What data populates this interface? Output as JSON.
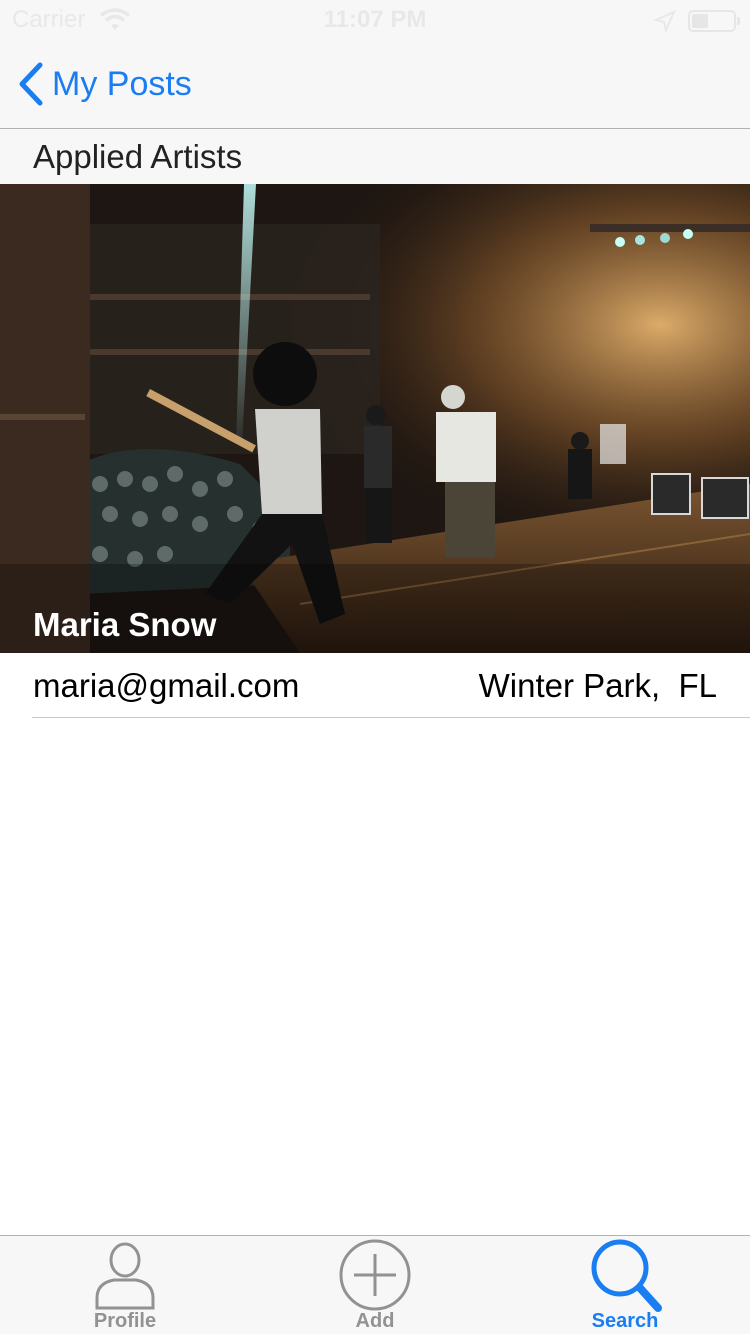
{
  "status_bar": {
    "carrier": "Carrier",
    "time": "11:07 PM",
    "icons": [
      "wifi-icon",
      "location-arrow-icon",
      "battery-icon"
    ]
  },
  "nav": {
    "back_label": "My Posts",
    "back_icon": "chevron-left-icon"
  },
  "section": {
    "title": "Applied Artists"
  },
  "artists": [
    {
      "name": "Maria Snow",
      "email": "maria@gmail.com",
      "location": "Winter Park,  FL",
      "photo": "concert-stage-photo"
    }
  ],
  "tab_bar": {
    "tabs": [
      {
        "label": "Profile",
        "icon": "person-icon",
        "active": false
      },
      {
        "label": "Add",
        "icon": "plus-circle-icon",
        "active": false
      },
      {
        "label": "Search",
        "icon": "search-icon",
        "active": true
      }
    ]
  },
  "colors": {
    "accent": "#1a7ef2",
    "inactive": "#929292",
    "bar_background": "#f7f7f7",
    "separator": "#c8c7cc"
  }
}
